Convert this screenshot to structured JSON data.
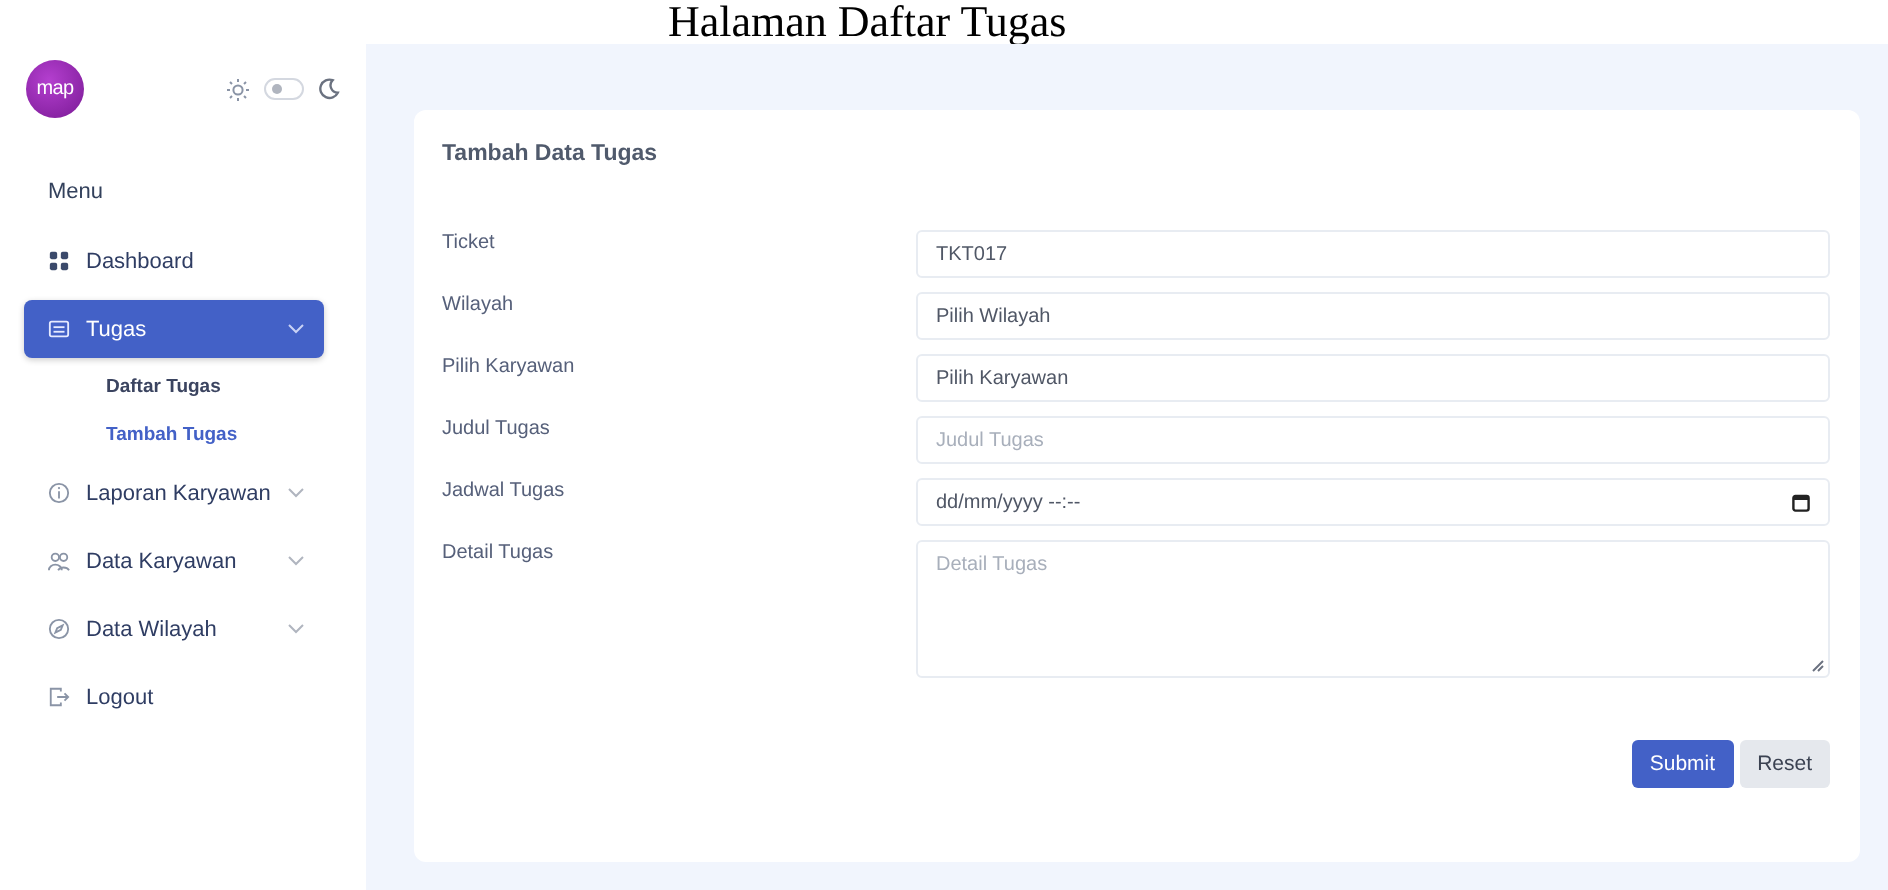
{
  "page_title": "Halaman Daftar Tugas",
  "sidebar": {
    "logo": "map",
    "theme_toggle": {
      "on": false
    },
    "menu_label": "Menu",
    "items": [
      {
        "label": "Dashboard",
        "kind": "link",
        "selected": false
      },
      {
        "label": "Tugas",
        "kind": "group",
        "selected": true,
        "children": [
          {
            "label": "Daftar Tugas",
            "selected": false
          },
          {
            "label": "Tambah Tugas",
            "selected": true
          }
        ]
      },
      {
        "label": "Laporan Karyawan",
        "kind": "group",
        "selected": false
      },
      {
        "label": "Data Karyawan",
        "kind": "group",
        "selected": false
      },
      {
        "label": "Data Wilayah",
        "kind": "group",
        "selected": false
      },
      {
        "label": "Logout",
        "kind": "link",
        "selected": false
      }
    ]
  },
  "form": {
    "title": "Tambah Data Tugas",
    "fields": [
      {
        "label": "Ticket",
        "kind": "text",
        "value": "TKT017"
      },
      {
        "label": "Wilayah",
        "kind": "select",
        "value": "Pilih Wilayah"
      },
      {
        "label": "Pilih Karyawan",
        "kind": "select",
        "value": "Pilih Karyawan"
      },
      {
        "label": "Judul Tugas",
        "kind": "text",
        "placeholder": "Judul Tugas"
      },
      {
        "label": "Jadwal Tugas",
        "kind": "datetime",
        "value": "dd/mm/yyyy --:--"
      },
      {
        "label": "Detail Tugas",
        "kind": "textarea",
        "placeholder": "Detail Tugas"
      }
    ],
    "buttons": [
      {
        "label": "Submit",
        "kind": "primary"
      },
      {
        "label": "Reset",
        "kind": "secondary"
      }
    ]
  }
}
